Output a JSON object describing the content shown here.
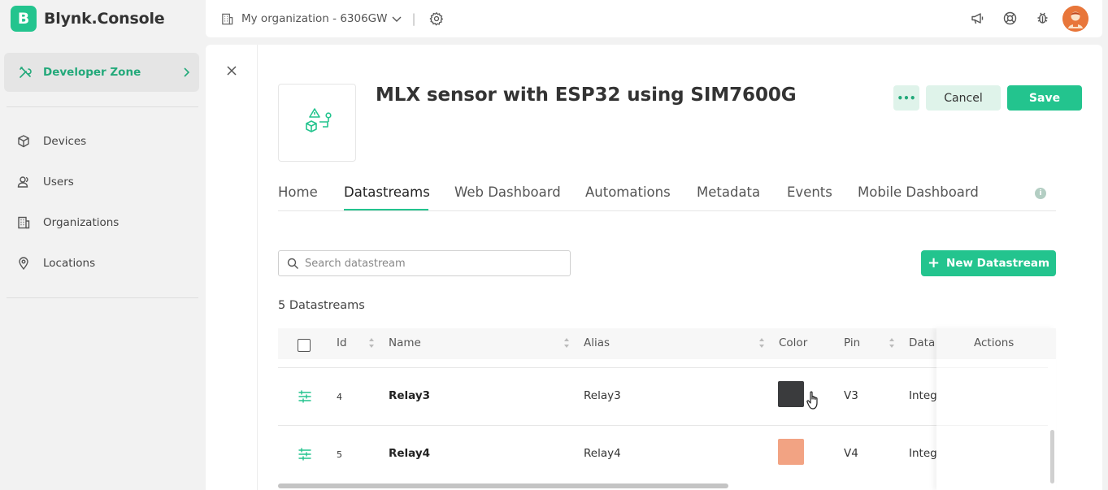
{
  "brand": {
    "logo_letter": "B",
    "name": "Blynk.Console",
    "color": "#23c48e"
  },
  "sidebar": {
    "developer_zone": {
      "label": "Developer Zone",
      "icon": "tools-icon"
    },
    "items": [
      {
        "label": "Devices",
        "icon": "cube-icon"
      },
      {
        "label": "Users",
        "icon": "users-icon"
      },
      {
        "label": "Organizations",
        "icon": "building-icon"
      },
      {
        "label": "Locations",
        "icon": "pin-icon"
      }
    ]
  },
  "topbar": {
    "organization": "My organization - 6306GW",
    "separator": "|",
    "icons": [
      "megaphone-icon",
      "help-icon",
      "bug-icon",
      "avatar"
    ]
  },
  "template": {
    "title": "MLX sensor with ESP32 using SIM7600G",
    "more_label": "•••",
    "cancel_label": "Cancel",
    "save_label": "Save"
  },
  "tabs": [
    {
      "label": "Home",
      "active": false
    },
    {
      "label": "Datastreams",
      "active": true
    },
    {
      "label": "Web Dashboard",
      "active": false
    },
    {
      "label": "Automations",
      "active": false
    },
    {
      "label": "Metadata",
      "active": false
    },
    {
      "label": "Events",
      "active": false
    },
    {
      "label": "Mobile Dashboard",
      "active": false
    }
  ],
  "info_glyph": "i",
  "datastreams": {
    "search_placeholder": "Search datastream",
    "new_button": "New Datastream",
    "new_button_plus": "+",
    "count_label": "5 Datastreams",
    "columns": {
      "id": "Id",
      "name": "Name",
      "alias": "Alias",
      "color": "Color",
      "pin": "Pin",
      "data": "Data",
      "actions": "Actions"
    },
    "rows": [
      {
        "id": "4",
        "name": "Relay3",
        "alias": "Relay3",
        "color": "#3a3b3d",
        "pin": "V3",
        "data": "Integ"
      },
      {
        "id": "5",
        "name": "Relay4",
        "alias": "Relay4",
        "color": "#f2a383",
        "pin": "V4",
        "data": "Integ"
      }
    ]
  }
}
